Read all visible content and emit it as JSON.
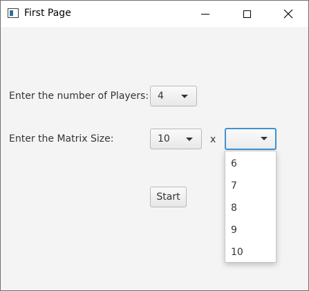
{
  "window": {
    "title": "First Page",
    "icon": "app-window-icon",
    "controls": [
      "minimize-icon",
      "maximize-icon",
      "close-icon"
    ]
  },
  "form": {
    "players_label": "Enter the number of Players:",
    "players_value": "4",
    "matrix_label": "Enter the Matrix Size:",
    "matrix_rows_value": "10",
    "separator": "x",
    "matrix_cols_value": "",
    "start_label": "Start"
  },
  "dropdown": {
    "options": [
      "6",
      "7",
      "8",
      "9",
      "10"
    ]
  },
  "colors": {
    "focus": "#3c92cf",
    "window_bg": "#f4f4f4",
    "titlebar_bg": "#ffffff"
  }
}
